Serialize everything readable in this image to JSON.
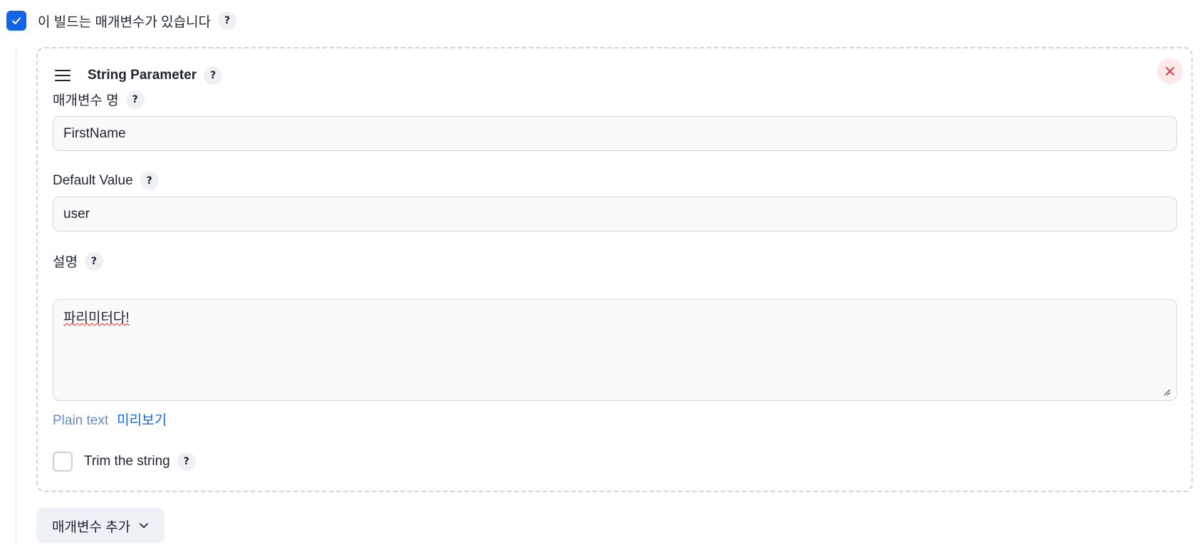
{
  "parameterized": {
    "checked": true,
    "label": "이 빌드는 매개변수가 있습니다",
    "help": "?"
  },
  "parameter": {
    "title": "String Parameter",
    "help": "?",
    "name_field": {
      "label": "매개변수 명",
      "help": "?",
      "value": "FirstName"
    },
    "default_field": {
      "label": "Default Value",
      "help": "?",
      "value": "user"
    },
    "description_field": {
      "label": "설명",
      "help": "?",
      "value": "파리미터다!"
    },
    "format": {
      "plain_text": "Plain text",
      "preview": "미리보기"
    },
    "trim": {
      "checked": false,
      "label": "Trim the string",
      "help": "?"
    }
  },
  "add_parameter": {
    "label": "매개변수 추가"
  },
  "icons": {
    "check": "check-icon",
    "drag": "drag-handle-icon",
    "close": "close-icon",
    "chevron": "chevron-down-icon"
  },
  "colors": {
    "accent": "#1464e6",
    "close_bg": "#fde8ea",
    "close_fg": "#d92d3c"
  }
}
